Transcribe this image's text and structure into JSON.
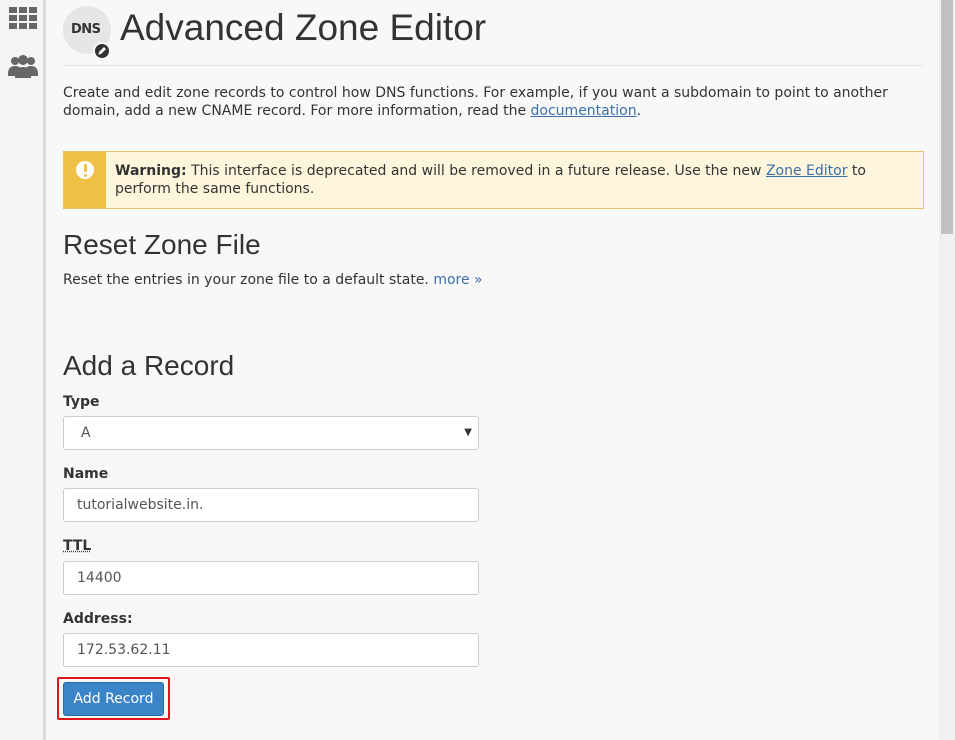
{
  "sidebar": {
    "items": [
      {
        "icon": "apps-grid-icon"
      },
      {
        "icon": "users-icon"
      }
    ]
  },
  "header": {
    "icon_label": "DNS",
    "title": "Advanced Zone Editor"
  },
  "intro": {
    "text": "Create and edit zone records to control how DNS functions. For example, if you want a subdomain to point to another domain, add a new CNAME record. For more information, read the ",
    "link": "documentation",
    "end": "."
  },
  "warning": {
    "strong": "Warning:",
    "text": " This interface is deprecated and will be removed in a future release. Use the new ",
    "link": "Zone Editor",
    "end": " to perform the same functions.",
    "accent_color": "#f0bf45"
  },
  "reset": {
    "title": "Reset Zone File",
    "description": "Reset the entries in your zone file to a default state. ",
    "more_link": "more »"
  },
  "add_record": {
    "title": "Add a Record",
    "type_label": "Type",
    "type_value": "A",
    "name_label": "Name",
    "name_value": "tutorialwebsite.in.",
    "ttl_label": "TTL",
    "ttl_value": "14400",
    "address_label": "Address:",
    "address_value": "172.53.62.11",
    "submit_label": "Add Record",
    "submit_color": "#3b84c7",
    "highlight_color": "#e0141e"
  }
}
